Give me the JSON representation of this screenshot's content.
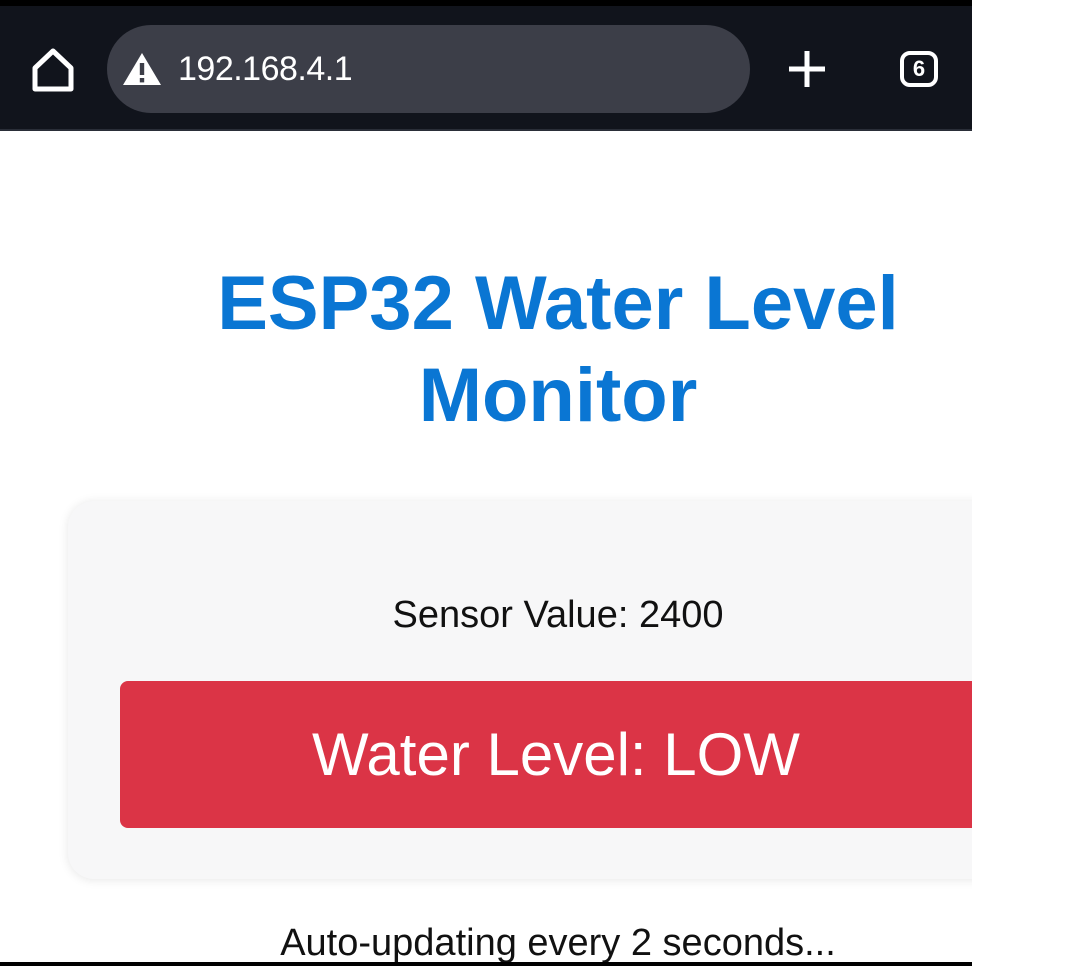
{
  "browser": {
    "url": "192.168.4.1",
    "tab_count": "6",
    "icons": {
      "home": "home-icon",
      "warning": "warning-icon",
      "new_tab": "plus-icon",
      "tabs": "tab-switcher-icon"
    },
    "colors": {
      "toolbar_bg": "#11141c",
      "urlbar_bg": "#3c3e48"
    }
  },
  "page": {
    "title": "ESP32 Water Level Monitor",
    "sensor_label": "Sensor Value: 2400",
    "level_status": "Water Level: LOW",
    "footer": "Auto-updating every 2 seconds...",
    "colors": {
      "title": "#0a76d3",
      "status_low_bg": "#db3446",
      "card_bg": "#f7f7f8"
    }
  }
}
